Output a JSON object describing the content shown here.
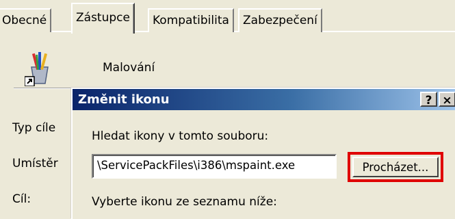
{
  "tabs": [
    {
      "label": "Obecné",
      "active": false
    },
    {
      "label": "Zástupce",
      "active": true
    },
    {
      "label": "Kompatibilita",
      "active": false
    },
    {
      "label": "Zabezpečení",
      "active": false
    }
  ],
  "shortcut": {
    "icon": "paint-brushes-icon",
    "name": "Malování",
    "labels": {
      "type": "Typ cíle",
      "location": "Umístěr",
      "target": "Cíl:"
    }
  },
  "dialog": {
    "title": "Změnit ikonu",
    "help_button": "?",
    "close_button": "×",
    "search_label": "Hledat ikony v tomto souboru:",
    "file_path": "\\ServicePackFiles\\i386\\mspaint.exe",
    "browse_button": "Procházet...",
    "select_label": "Vyberte ikonu ze seznamu níže:"
  },
  "colors": {
    "highlight": "#e00000",
    "titlebar_start": "#0a246a",
    "titlebar_end": "#a6caf0"
  }
}
